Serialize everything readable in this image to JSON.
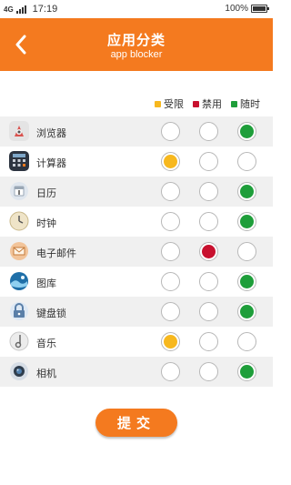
{
  "status_bar": {
    "network": "4G",
    "time": "17:19",
    "battery": "100%"
  },
  "header": {
    "title": "应用分类",
    "subtitle": "app blocker"
  },
  "legend": [
    {
      "label": "受限",
      "color": "#f7b81e"
    },
    {
      "label": "禁用",
      "color": "#c8102e"
    },
    {
      "label": "随时",
      "color": "#1e9e3a"
    }
  ],
  "colors": {
    "accent": "#f47a1f",
    "restricted": "#f7b81e",
    "disabled": "#c8102e",
    "anytime": "#1e9e3a"
  },
  "apps": [
    {
      "name": "浏览器",
      "icon": "browser-icon",
      "selected": "anytime"
    },
    {
      "name": "计算器",
      "icon": "calculator-icon",
      "selected": "restricted"
    },
    {
      "name": "日历",
      "icon": "calendar-icon",
      "selected": "anytime"
    },
    {
      "name": "时钟",
      "icon": "clock-icon",
      "selected": "anytime"
    },
    {
      "name": "电子邮件",
      "icon": "email-icon",
      "selected": "disabled"
    },
    {
      "name": "图库",
      "icon": "gallery-icon",
      "selected": "anytime"
    },
    {
      "name": "键盘锁",
      "icon": "keyguard-icon",
      "selected": "anytime"
    },
    {
      "name": "音乐",
      "icon": "music-icon",
      "selected": "restricted"
    },
    {
      "name": "相机",
      "icon": "camera-icon",
      "selected": "anytime"
    }
  ],
  "submit_label": "提交"
}
